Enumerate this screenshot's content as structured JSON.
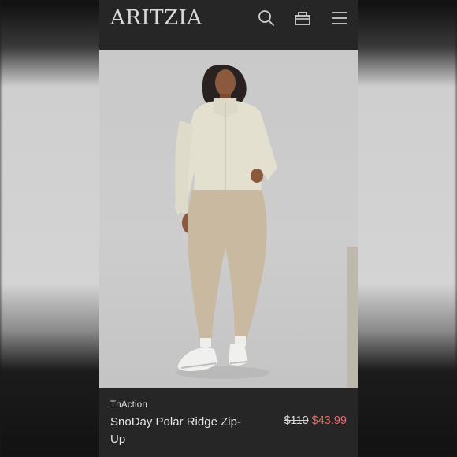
{
  "header": {
    "logo": "ARITZIA",
    "icons": [
      "search-icon",
      "bag-icon",
      "menu-icon"
    ]
  },
  "product": {
    "image_alt": "Model wearing cream fleece zip-up jacket with beige leggings and white sneakers",
    "brand": "TnAction",
    "name": "SnoDay Polar Ridge Zip-Up",
    "original_price": "$110",
    "sale_price": "$43.99"
  },
  "colors": {
    "sale": "#e36a6a",
    "header_bg": "#262626"
  }
}
